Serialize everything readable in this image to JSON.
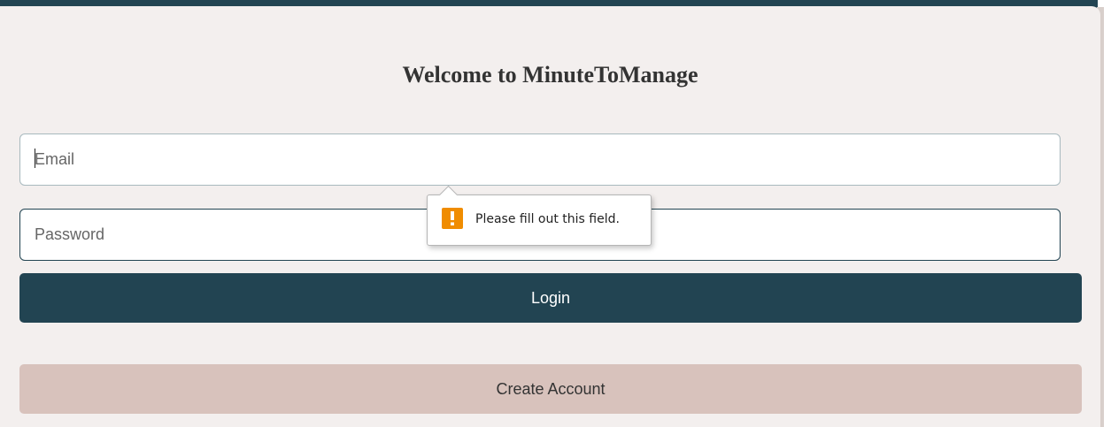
{
  "header": {
    "title": "Welcome to MinuteToManage"
  },
  "form": {
    "email_placeholder": "Email",
    "email_value": "",
    "password_placeholder": "Password",
    "password_value": "",
    "login_label": "Login",
    "create_account_label": "Create Account"
  },
  "validation": {
    "message": "Please fill out this field.",
    "icon": "warning-icon"
  },
  "colors": {
    "primary": "#224452",
    "secondary": "#d8c2bc",
    "background": "#f3efee",
    "warning": "#f08c00"
  }
}
